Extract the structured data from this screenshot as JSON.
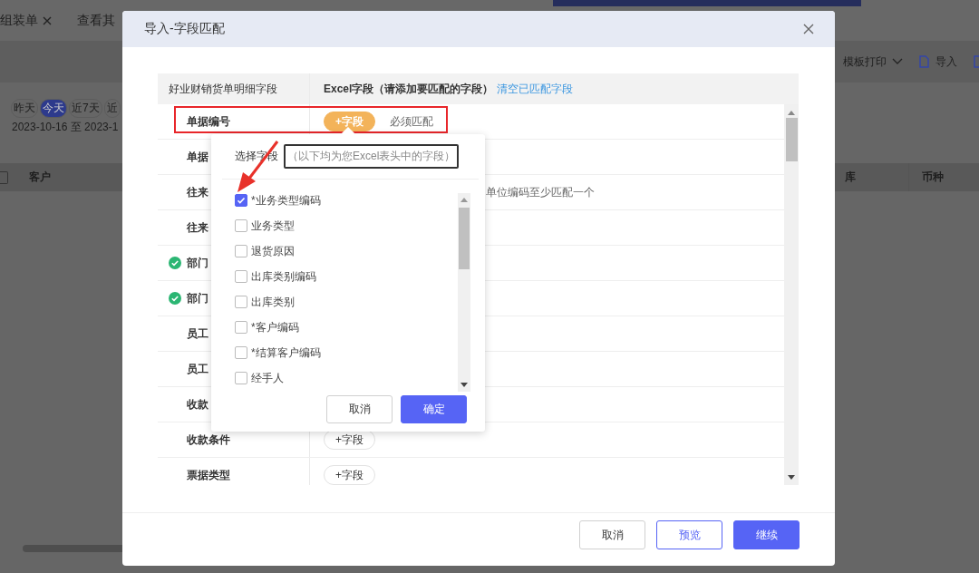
{
  "background": {
    "tabs": [
      {
        "label": "组装单",
        "closable": true
      },
      {
        "label": "查看其",
        "closable": false
      }
    ],
    "toolbar": [
      {
        "label": "模板打印",
        "kind": "dropdown"
      },
      {
        "label": "导入",
        "kind": "import"
      }
    ],
    "date_chips": [
      {
        "label": "昨天",
        "selected": false
      },
      {
        "label": "今天",
        "selected": true
      },
      {
        "label": "近7天",
        "selected": false
      },
      {
        "label": "近",
        "selected": false
      }
    ],
    "date_range": "2023-10-16 至 2023-1",
    "select_all": {
      "checked": false
    },
    "columns": [
      "客户",
      "库",
      "币种"
    ]
  },
  "dialog": {
    "title": "导入-字段匹配",
    "table": {
      "columns": [
        "好业财销货单明细字段",
        "Excel字段（请添加要匹配的字段）"
      ],
      "clear_link": "清空已匹配字段",
      "rows": [
        {
          "field": "单据编号",
          "matched": false,
          "add": {
            "label": "+字段",
            "selected": true
          },
          "note": "必须匹配"
        },
        {
          "field": "单据",
          "matched": false
        },
        {
          "field": "往来",
          "matched": false,
          "note": "单位编码至少匹配一个"
        },
        {
          "field": "往来",
          "matched": false
        },
        {
          "field": "部门",
          "matched": true
        },
        {
          "field": "部门",
          "matched": true
        },
        {
          "field": "员工",
          "matched": false
        },
        {
          "field": "员工",
          "matched": false
        },
        {
          "field": "收款",
          "matched": false
        },
        {
          "field": "收款条件",
          "matched": false,
          "add": {
            "label": "+字段",
            "selected": false
          }
        },
        {
          "field": "票据类型",
          "matched": false,
          "add": {
            "label": "+字段",
            "selected": false
          }
        }
      ]
    },
    "popover": {
      "title": "选择字段",
      "hint": "（以下均为您Excel表头中的字段）",
      "options": [
        {
          "label": "*业务类型编码",
          "checked": true
        },
        {
          "label": "业务类型",
          "checked": false
        },
        {
          "label": "退货原因",
          "checked": false
        },
        {
          "label": "出库类别编码",
          "checked": false
        },
        {
          "label": "出库类别",
          "checked": false
        },
        {
          "label": "*客户编码",
          "checked": false
        },
        {
          "label": "*结算客户编码",
          "checked": false
        },
        {
          "label": "经手人",
          "checked": false
        }
      ],
      "buttons": [
        {
          "label": "取消",
          "kind": "plain"
        },
        {
          "label": "确定",
          "kind": "primary"
        }
      ]
    },
    "buttons": [
      {
        "label": "取消",
        "kind": "plain"
      },
      {
        "label": "预览",
        "kind": "outline"
      },
      {
        "label": "继续",
        "kind": "primary"
      }
    ]
  }
}
